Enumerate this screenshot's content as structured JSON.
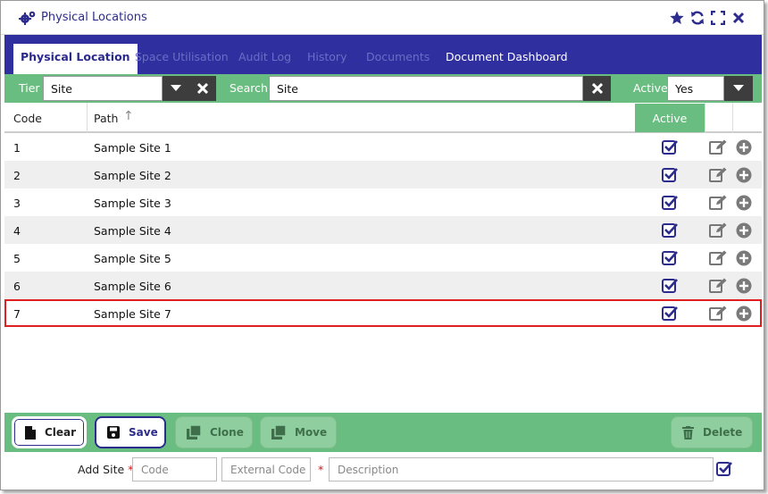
{
  "window": {
    "title": "Physical Locations"
  },
  "tabs": [
    {
      "label": "Physical Location"
    },
    {
      "label": "Space Utilisation"
    },
    {
      "label": "Audit Log"
    },
    {
      "label": "History"
    },
    {
      "label": "Documents"
    },
    {
      "label": "Document Dashboard"
    }
  ],
  "filter": {
    "tier_label": "Tier",
    "tier_value": "Site",
    "search_label": "Search",
    "search_value": "Site",
    "active_label": "Active",
    "active_value": "Yes"
  },
  "table": {
    "headers": {
      "code": "Code",
      "path": "Path",
      "active": "Active"
    },
    "sort_indicator": "↑",
    "rows": [
      {
        "code": "1",
        "path": "Sample Site 1",
        "active": true
      },
      {
        "code": "2",
        "path": "Sample Site 2",
        "active": true
      },
      {
        "code": "3",
        "path": "Sample Site 3",
        "active": true
      },
      {
        "code": "4",
        "path": "Sample Site 4",
        "active": true
      },
      {
        "code": "5",
        "path": "Sample Site 5",
        "active": true
      },
      {
        "code": "6",
        "path": "Sample Site 6",
        "active": true
      },
      {
        "code": "7",
        "path": "Sample Site 7",
        "active": true
      }
    ],
    "selected_row": "7"
  },
  "actions": {
    "clear": "Clear",
    "save": "Save",
    "clone": "Clone",
    "move": "Move",
    "delete": "Delete"
  },
  "add_site": {
    "label": "Add Site",
    "required_mark": "*",
    "code_placeholder": "Code",
    "external_code_placeholder": "External Code",
    "description_placeholder": "Description"
  },
  "colors": {
    "navy": "#2f2fa0",
    "green": "#6abd80",
    "selection": "#e02020"
  },
  "icons": [
    "settings-icon",
    "star-icon",
    "refresh-icon",
    "expand-icon",
    "close-icon",
    "caret-down-icon",
    "clear-x-icon",
    "sort-up-icon",
    "checkbox-checked-icon",
    "edit-icon",
    "add-circle-icon",
    "file-icon",
    "save-icon",
    "clone-icon",
    "move-icon",
    "trash-icon"
  ]
}
